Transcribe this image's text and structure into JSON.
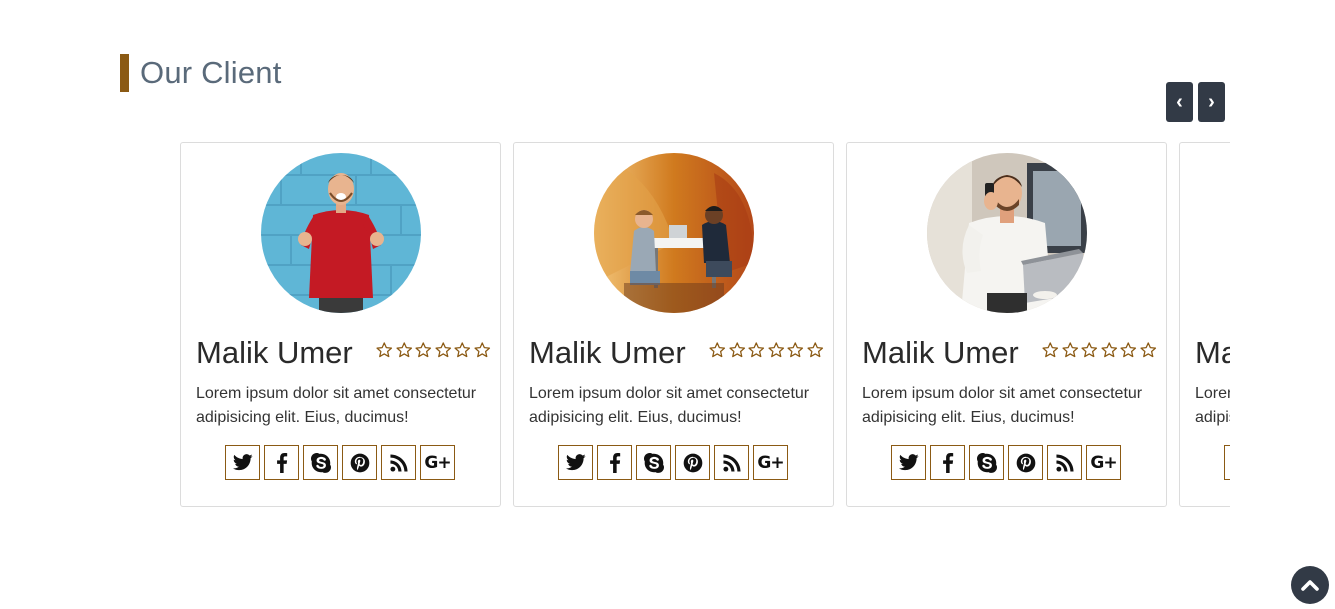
{
  "section": {
    "title": "Our Client"
  },
  "carousel": {
    "prev_label": "‹",
    "next_label": "›"
  },
  "cards": [
    {
      "name": "Malik Umer",
      "rating": 0,
      "max_rating": 6,
      "description": "Lorem ipsum dolor sit amet consectetur adipisicing elit. Eius, ducimus!",
      "photo": "man-in-red-sweater-cheering"
    },
    {
      "name": "Malik Umer",
      "rating": 0,
      "max_rating": 6,
      "description": "Lorem ipsum dolor sit amet consectetur adipisicing elit. Eius, ducimus!",
      "photo": "two-men-meeting-at-table"
    },
    {
      "name": "Malik Umer",
      "rating": 0,
      "max_rating": 6,
      "description": "Lorem ipsum dolor sit amet consectetur adipisicing elit. Eius, ducimus!",
      "photo": "man-on-phone-with-laptop"
    },
    {
      "name": "Malik Umer",
      "rating": 0,
      "max_rating": 6,
      "description": "Lorem ipsum dolor sit amet consectetur adipisicing elit. Eius, ducimus!",
      "photo": "partially-visible"
    }
  ],
  "social_icons": [
    "twitter-icon",
    "facebook-icon",
    "skype-icon",
    "pinterest-icon",
    "rss-icon",
    "google-plus-icon"
  ],
  "social_gplus_text": "G+",
  "colors": {
    "accent": "#8b5a14",
    "dark": "#323a46",
    "title": "#5a6a7a"
  },
  "scroll_top_icon": "chevron-up-icon"
}
